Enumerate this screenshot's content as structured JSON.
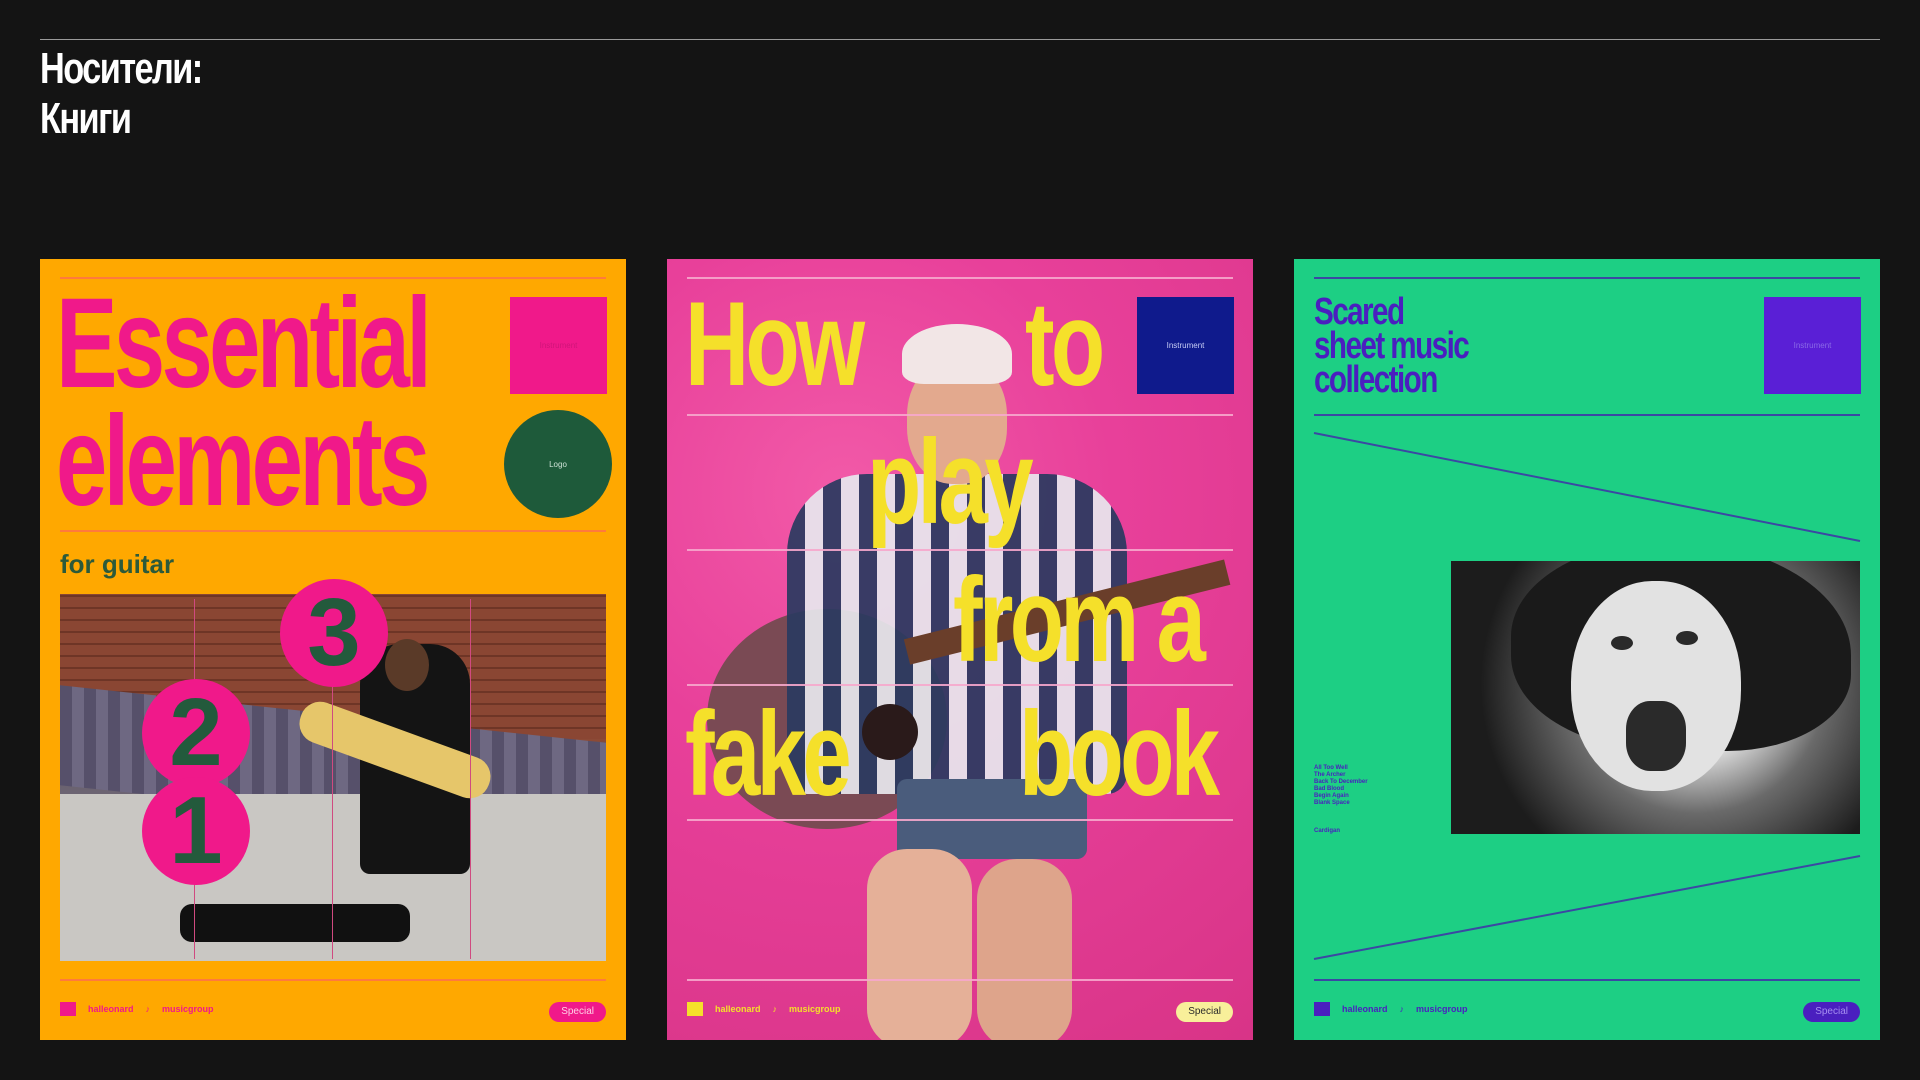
{
  "heading": {
    "line1": "Носители:",
    "line2": "Книги"
  },
  "books": [
    {
      "title_line1": "Essential",
      "title_line2": "elements",
      "subtitle": "for guitar",
      "square_label": "Instrument",
      "logo_label": "Logo",
      "numbers": [
        "3",
        "2",
        "1"
      ],
      "footer_logo1": "halleonard",
      "footer_logo2": "musicgroup",
      "badge": "Special",
      "colors": {
        "bg": "#ffa800",
        "accent": "#f0198a",
        "text": "#2c5a3a"
      }
    },
    {
      "words": [
        "How",
        "to",
        "play",
        "from a",
        "fake",
        "book"
      ],
      "square_label": "Instrument",
      "footer_logo1": "halleonard",
      "footer_logo2": "musicgroup",
      "badge": "Special",
      "colors": {
        "bg": "#e8409a",
        "accent": "#f5e02a",
        "square": "#0f1a8c"
      }
    },
    {
      "title_line1": "Scared",
      "title_line2": "sheet music",
      "title_line3": "collection",
      "square_label": "Instrument",
      "tracks": [
        "All Too Well",
        "The Archer",
        "Back To December",
        "Bad Blood",
        "Begin Again",
        "Blank Space"
      ],
      "small_note": "Cardigan",
      "footer_logo1": "halleonard",
      "footer_logo2": "musicgroup",
      "badge": "Special",
      "colors": {
        "bg": "#1dcf84",
        "accent": "#4a1fbf"
      }
    }
  ]
}
